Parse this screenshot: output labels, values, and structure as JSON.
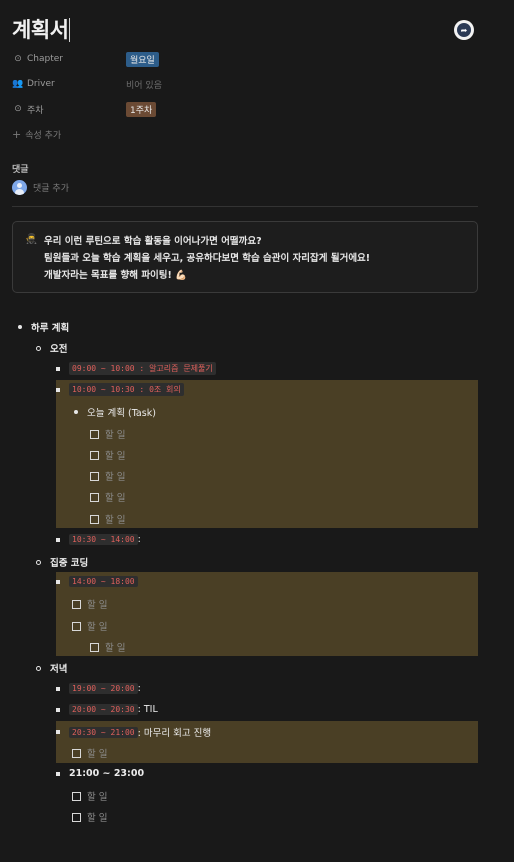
{
  "page": {
    "title": "계획서"
  },
  "properties": [
    {
      "icon": "chevron-circle-icon",
      "name": "Chapter",
      "value": "월요일",
      "type": "tag",
      "color": "#2d5d8a"
    },
    {
      "icon": "people-icon",
      "name": "Driver",
      "value": "비어 있음",
      "type": "empty"
    },
    {
      "icon": "chevron-circle-icon",
      "name": "주차",
      "value": "1주차",
      "type": "tag",
      "color": "#6b4a34"
    }
  ],
  "add_property": "속성 추가",
  "comments": {
    "heading": "댓글",
    "placeholder": "댓글 추가"
  },
  "callout": {
    "icon": "callout-emoji-icon",
    "lines": [
      "우리 이런 루틴으로 학습 활동을 이어나가면 어떨까요?",
      "팀원들과 오늘 학습 계획을 세우고, 공유하다보면 학습 습관이 자리잡게 될거에요!",
      "개발자라는 목표를 향해 파이팅! 💪🏻"
    ]
  },
  "plan": {
    "heading": "하루 계획",
    "morning": {
      "label": "오전",
      "item1_code": "09:00 ~ 10:00 : 알고리즘 문제풀기",
      "item2_code": "10:00 ~ 10:30 : 0조 회의",
      "task_label": "오늘 계획 (Task)",
      "todos": [
        "할 일",
        "할 일",
        "할 일",
        "할 일",
        "할 일"
      ],
      "item3_code": "10:30 ~ 14:00",
      "item3_suffix": " :"
    },
    "focus": {
      "label": "집중 코딩",
      "item_code": "14:00 ~ 18:00",
      "todos": [
        "할 일",
        "할 일"
      ],
      "subtodo": "할 일"
    },
    "evening": {
      "label": "저녁",
      "item1_code": "19:00 ~ 20:00",
      "item1_suffix": " :",
      "item2_code": "20:00 ~ 20:30",
      "item2_suffix": " : TIL",
      "item3_code": "20:30 ~ 21:00",
      "item3_suffix": " : 마무리 회고 진행",
      "item3_todo": "할 일",
      "item4": "21:00 ~ 23:00",
      "item4_todos": [
        "할 일",
        "할 일"
      ]
    }
  }
}
